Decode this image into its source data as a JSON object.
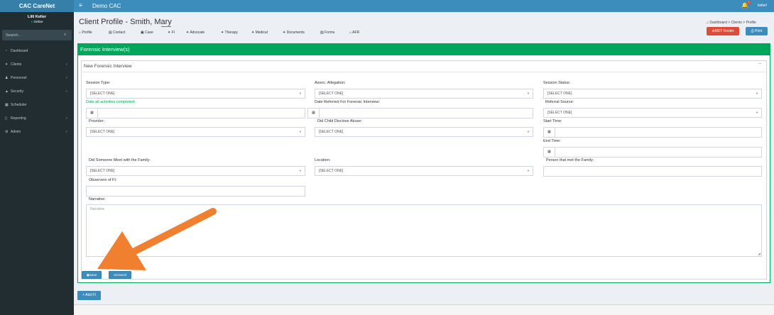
{
  "topbar": {
    "brand": "CAC CareNet",
    "menu_icon": "hamburger-icon",
    "app_title": "Demo CAC",
    "notification_count": "1",
    "user": "kellerl"
  },
  "sidebar": {
    "user_name": "Lilli Keller",
    "user_status": "Online",
    "search_placeholder": "Search...",
    "items": [
      {
        "label": "Dashboard",
        "icon": "dashboard-icon",
        "glyph": "◔",
        "chevron": ""
      },
      {
        "label": "Clients",
        "icon": "person-icon",
        "glyph": "✦",
        "chevron": "‹"
      },
      {
        "label": "Personnel",
        "icon": "user-icon",
        "glyph": "♟",
        "chevron": "‹"
      },
      {
        "label": "Security",
        "icon": "lock-icon",
        "glyph": "🔒",
        "chevron": "‹"
      },
      {
        "label": "Scheduler",
        "icon": "calendar-icon",
        "glyph": "▦",
        "chevron": ""
      },
      {
        "label": "Reporting",
        "icon": "file-icon",
        "glyph": "▯",
        "chevron": "‹"
      },
      {
        "label": "Admin",
        "icon": "gears-icon",
        "glyph": "⚙",
        "chevron": "‹"
      }
    ]
  },
  "header": {
    "title": "Client Profile - Smith, Mary",
    "breadcrumb": [
      "Dashboard",
      "Clients",
      "Profile"
    ],
    "mdt_button": "MDT Roster",
    "print_button": "Print"
  },
  "tabs": [
    {
      "label": "Profile",
      "glyph": "⌂"
    },
    {
      "label": "Contact",
      "glyph": "▤"
    },
    {
      "label": "Case",
      "glyph": "▣"
    },
    {
      "label": "FI",
      "glyph": "✦"
    },
    {
      "label": "Advocate",
      "glyph": "✦"
    },
    {
      "label": "Therapy",
      "glyph": "✦"
    },
    {
      "label": "Medical",
      "glyph": "✦"
    },
    {
      "label": "Documents",
      "glyph": "✦"
    },
    {
      "label": "Forms",
      "glyph": "▧"
    },
    {
      "label": "AFR",
      "glyph": "⌂"
    }
  ],
  "section": {
    "title": "Forensic Interview(s)",
    "subtitle": "New Forensic Interview",
    "collapse_glyph": "−"
  },
  "form": {
    "session_type_label": "Session Type:",
    "session_type_value": "[SELECT ONE]",
    "assoc_allegation_label": "Assoc. Allegation:",
    "assoc_allegation_value": "[SELECT ONE]",
    "session_status_label": "Session Status:",
    "session_status_value": "[SELECT ONE]",
    "date_completed_label": "Date all activities completed:",
    "date_referred_label": "Date Referred For Forensic Interview:",
    "referral_source_label": "Referral Source:",
    "referral_source_value": "[SELECT ONE]",
    "provider_label": "Provider:",
    "provider_value": "[SELECT ONE]",
    "did_disclose_label": "Did Child Disclose Abuse:",
    "did_disclose_value": "[SELECT ONE]",
    "start_time_label": "Start Time:",
    "end_time_label": "End Time:",
    "met_family_label": "Did Someone Meet with the Family:",
    "met_family_value": "[SELECT ONE]",
    "location_label": "Location:",
    "location_value": "[SELECT ONE]",
    "person_met_label": "Person that met the Family:",
    "observers_label": "Observers of FI:",
    "narrative_label": "Narrative:",
    "narrative_placeholder": "Narrative"
  },
  "buttons": {
    "save": "Save",
    "cancel": "Cancel",
    "add_fi": "+ Add FI"
  },
  "colors": {
    "primary": "#3c8dbc",
    "success": "#00a65a",
    "danger": "#dd4b39",
    "sidebar": "#222d32",
    "annotation_arrow": "#f07f2f"
  }
}
